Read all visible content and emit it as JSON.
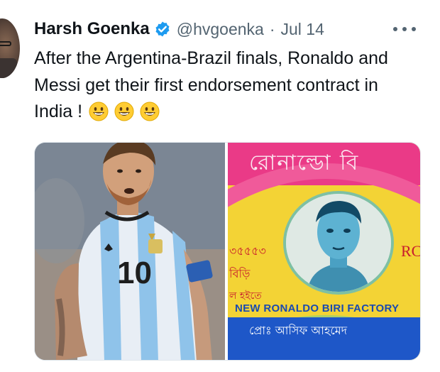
{
  "tweet": {
    "author_name": "Harsh Goenka",
    "handle": "@hvgoenka",
    "separator": "·",
    "date": "Jul 14",
    "text": "After the Argentina-Brazil finals, Ronaldo and Messi get their first endorsement contract in India !",
    "emojis": [
      "grinning-face",
      "grinning-face",
      "grinning-face"
    ]
  },
  "icons": {
    "verified": "verified-badge-icon",
    "more": "more-options-icon"
  },
  "media": {
    "left_jersey_number": "10",
    "right_top_bengali": "রোনাল্ডো বি",
    "right_factory_name": "NEW RONALDO BIRI FACTORY",
    "right_side_text_1": "৩৫৫৫৩",
    "right_side_text_2": "বিড়ি",
    "right_side_text_3": "ল হইতে",
    "right_side_rc": "RC",
    "right_bottom_bengali": "প্রোঃ আসিফ আহমেদ"
  },
  "colors": {
    "verified_blue": "#1d9bf0",
    "secondary_text": "#536471",
    "primary_text": "#0f1419",
    "pack_yellow": "#f3d335",
    "pack_pink": "#ea3a87",
    "pack_blue": "#1e57c8"
  }
}
